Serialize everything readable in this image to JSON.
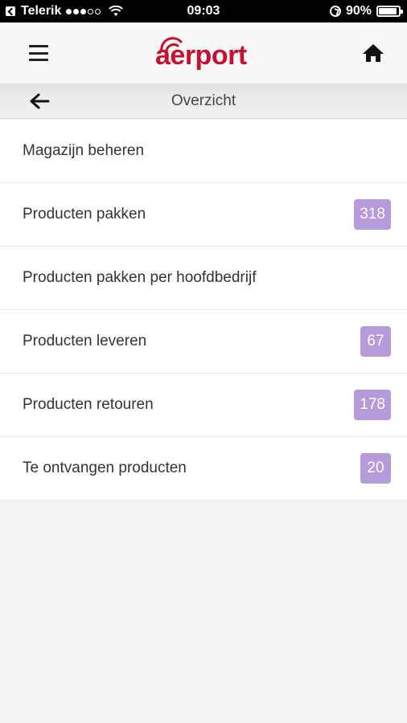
{
  "status_bar": {
    "carrier": "Telerik",
    "signal_dots": [
      true,
      true,
      true,
      false,
      false
    ],
    "time": "09:03",
    "battery": "90%",
    "battery_level": 0.9
  },
  "header": {
    "logo_text": "aerport",
    "brand_color": "#c8102e",
    "menu_icon": "hamburger-icon",
    "home_icon": "home-icon"
  },
  "sub_header": {
    "title": "Overzicht",
    "back_icon": "arrow-left-icon"
  },
  "badge_color": "#b59bd9",
  "menu": {
    "items": [
      {
        "label": "Magazijn beheren",
        "count": ""
      },
      {
        "label": "Producten pakken",
        "count": "318"
      },
      {
        "label": "Producten pakken per hoofdbedrijf",
        "count": ""
      },
      {
        "label": "Producten leveren",
        "count": "67"
      },
      {
        "label": "Producten retouren",
        "count": "178"
      },
      {
        "label": "Te ontvangen producten",
        "count": "20"
      }
    ]
  }
}
